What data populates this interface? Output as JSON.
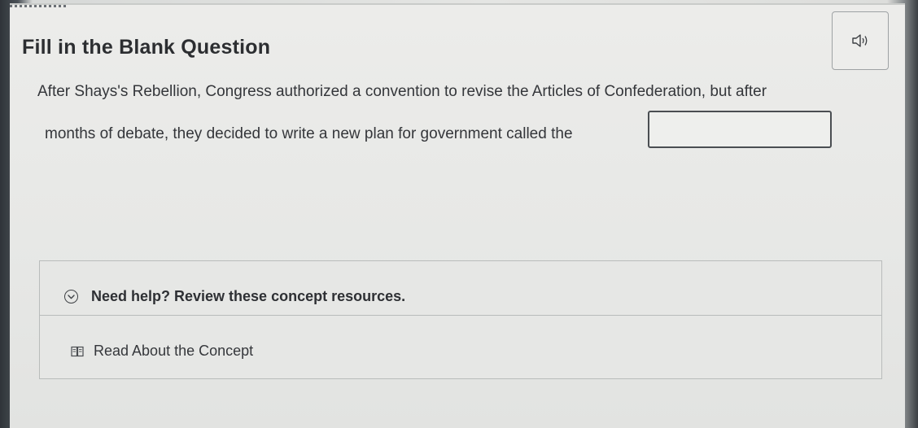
{
  "question": {
    "heading": "Fill in the Blank Question",
    "text_line1": "After Shays's Rebellion, Congress authorized a convention to revise the Articles of Confederation, but after",
    "text_line2": "months of debate, they decided to write a new plan for government called the",
    "blank_value": "",
    "audio_icon": "speaker-icon"
  },
  "help": {
    "toggle_icon": "chevron-down-circle-icon",
    "label": "Need help? Review these concept resources.",
    "resources": [
      {
        "icon": "book-icon",
        "label": "Read About the Concept"
      }
    ]
  },
  "colors": {
    "text": "#2c2e31",
    "border": "#b9bcbb",
    "input_border": "#4a4e52",
    "background": "#e7e8e6"
  }
}
